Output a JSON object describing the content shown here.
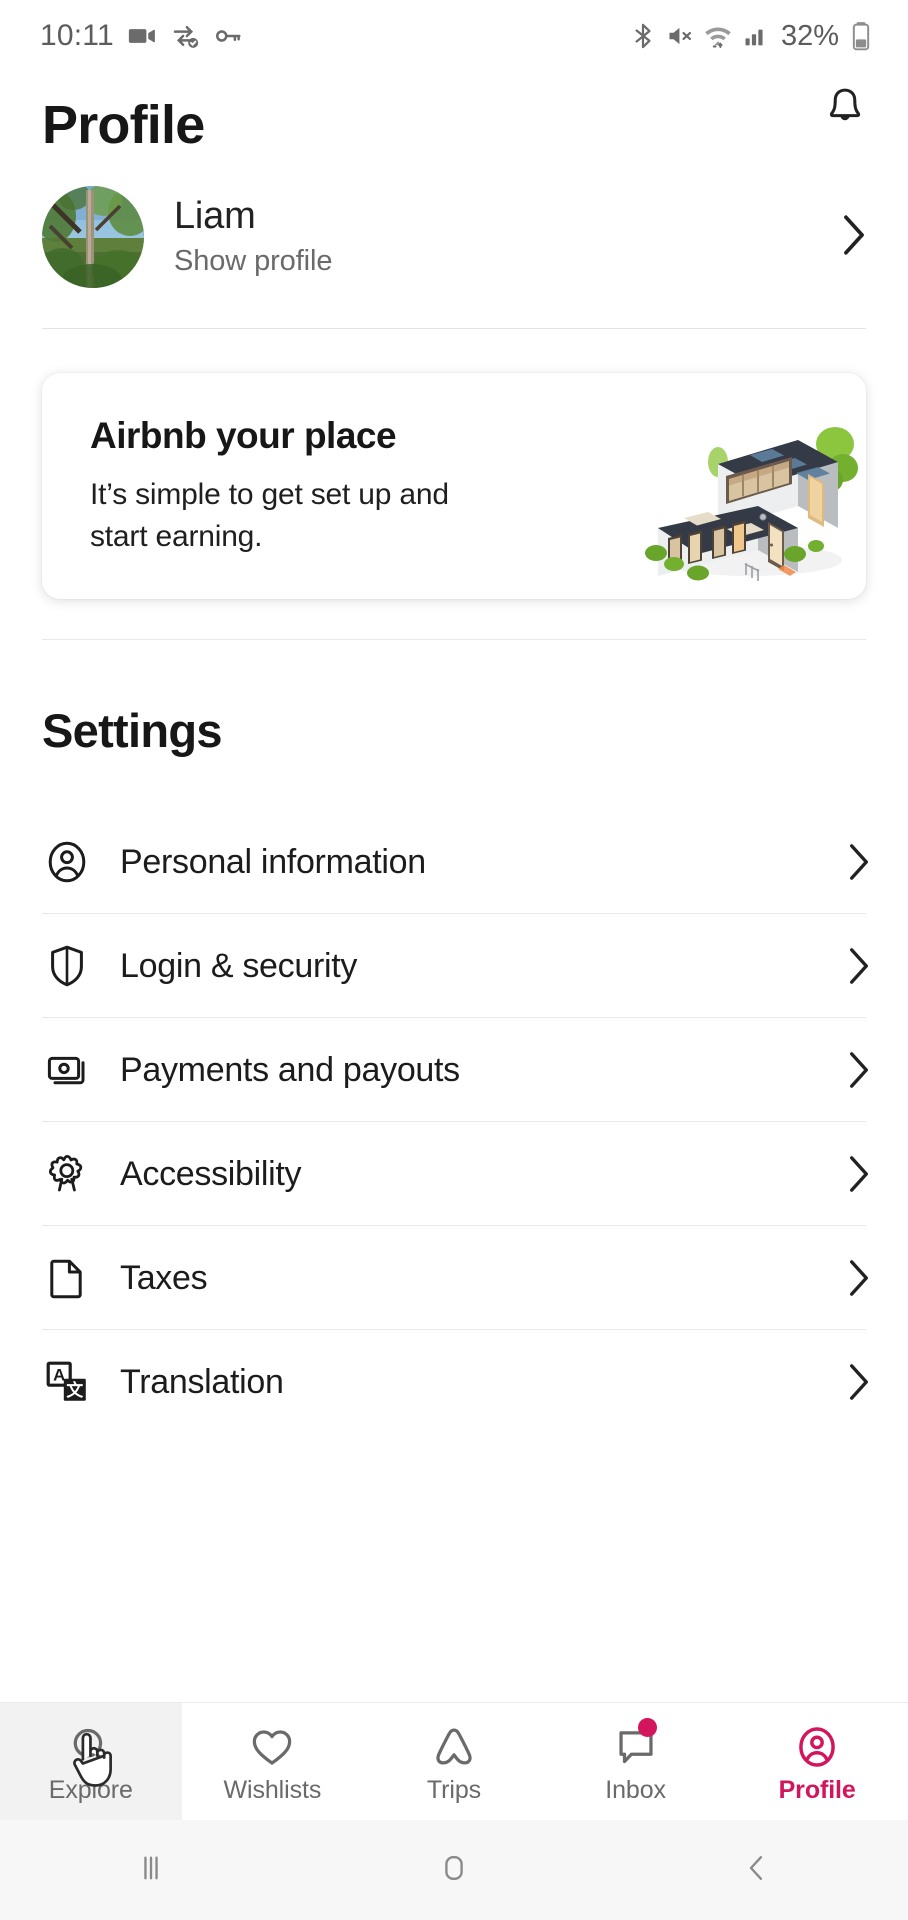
{
  "status_bar": {
    "time": "10:11",
    "battery_percent": "32%",
    "left_icons": [
      "video-camera-icon",
      "data-saver-icon",
      "vpn-key-icon"
    ],
    "right_icons": [
      "bluetooth-icon",
      "mute-icon",
      "wifi-icon",
      "signal-icon",
      "battery-icon"
    ]
  },
  "header": {
    "title": "Profile",
    "notifications_icon": "bell-icon"
  },
  "profile": {
    "name": "Liam",
    "subtitle": "Show profile",
    "avatar_icon": "avatar",
    "chevron_icon": "chevron-right-icon"
  },
  "host_card": {
    "title": "Airbnb your place",
    "subtitle": "It’s simple to get set up and start earning.",
    "illustration": "isometric-house-illustration"
  },
  "settings": {
    "heading": "Settings",
    "items": [
      {
        "label": "Personal information",
        "icon": "person-circle-icon"
      },
      {
        "label": "Login & security",
        "icon": "shield-icon"
      },
      {
        "label": "Payments and payouts",
        "icon": "banknotes-icon"
      },
      {
        "label": "Accessibility",
        "icon": "gear-icon"
      },
      {
        "label": "Taxes",
        "icon": "document-icon"
      },
      {
        "label": "Translation",
        "icon": "translate-icon"
      }
    ],
    "chevron_icon": "chevron-right-icon"
  },
  "bottom_nav": {
    "items": [
      {
        "label": "Explore",
        "icon": "magnifier-icon",
        "active": false,
        "badge": false
      },
      {
        "label": "Wishlists",
        "icon": "heart-icon",
        "active": false,
        "badge": false
      },
      {
        "label": "Trips",
        "icon": "airbnb-belo-icon",
        "active": false,
        "badge": false
      },
      {
        "label": "Inbox",
        "icon": "message-bubble-icon",
        "active": false,
        "badge": true
      },
      {
        "label": "Profile",
        "icon": "person-circle-icon",
        "active": true,
        "badge": false
      }
    ],
    "active_color": "#d2155c",
    "cursor_icon": "hand-pointer-cursor"
  },
  "android_nav": {
    "recents_icon": "recents-icon",
    "home_icon": "home-icon",
    "back_icon": "back-icon"
  }
}
